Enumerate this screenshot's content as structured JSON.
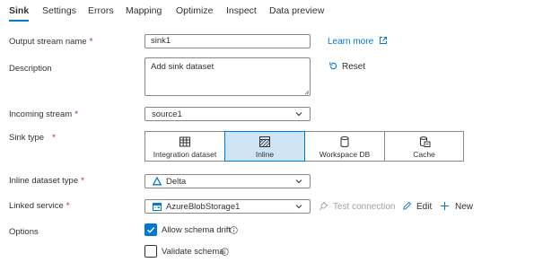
{
  "tabs": [
    {
      "label": "Sink",
      "active": true
    },
    {
      "label": "Settings",
      "active": false
    },
    {
      "label": "Errors",
      "active": false
    },
    {
      "label": "Mapping",
      "active": false
    },
    {
      "label": "Optimize",
      "active": false
    },
    {
      "label": "Inspect",
      "active": false
    },
    {
      "label": "Data preview",
      "active": false
    }
  ],
  "form": {
    "output_stream_name": {
      "label": "Output stream name",
      "required": "*",
      "value": "sink1"
    },
    "learn_more": "Learn more",
    "description": {
      "label": "Description",
      "value": "Add sink dataset"
    },
    "reset": "Reset",
    "incoming_stream": {
      "label": "Incoming stream",
      "required": "*",
      "value": "source1"
    },
    "sink_type": {
      "label": "Sink type",
      "required": "*",
      "options": [
        {
          "label": "Integration dataset",
          "icon": "table-icon",
          "selected": false
        },
        {
          "label": "Inline",
          "icon": "hatched-table-icon",
          "selected": true
        },
        {
          "label": "Workspace DB",
          "icon": "database-icon",
          "selected": false
        },
        {
          "label": "Cache",
          "icon": "cache-icon",
          "selected": false
        }
      ]
    },
    "inline_dataset_type": {
      "label": "Inline dataset type",
      "required": "*",
      "value": "Delta",
      "icon": "delta-icon"
    },
    "linked_service": {
      "label": "Linked service",
      "required": "*",
      "value": "AzureBlobStorage1",
      "icon": "blob-storage-icon"
    },
    "test_connection": "Test connection",
    "edit": "Edit",
    "new": "New",
    "options": {
      "label": "Options",
      "allow_schema_drift": {
        "label": "Allow schema drift",
        "checked": true
      },
      "validate_schema": {
        "label": "Validate schema",
        "checked": false
      }
    }
  },
  "colors": {
    "accent": "#0078d4",
    "selected_bg": "#cfe4f5",
    "required": "#a4262c",
    "text": "#323130",
    "border": "#8a8886"
  }
}
